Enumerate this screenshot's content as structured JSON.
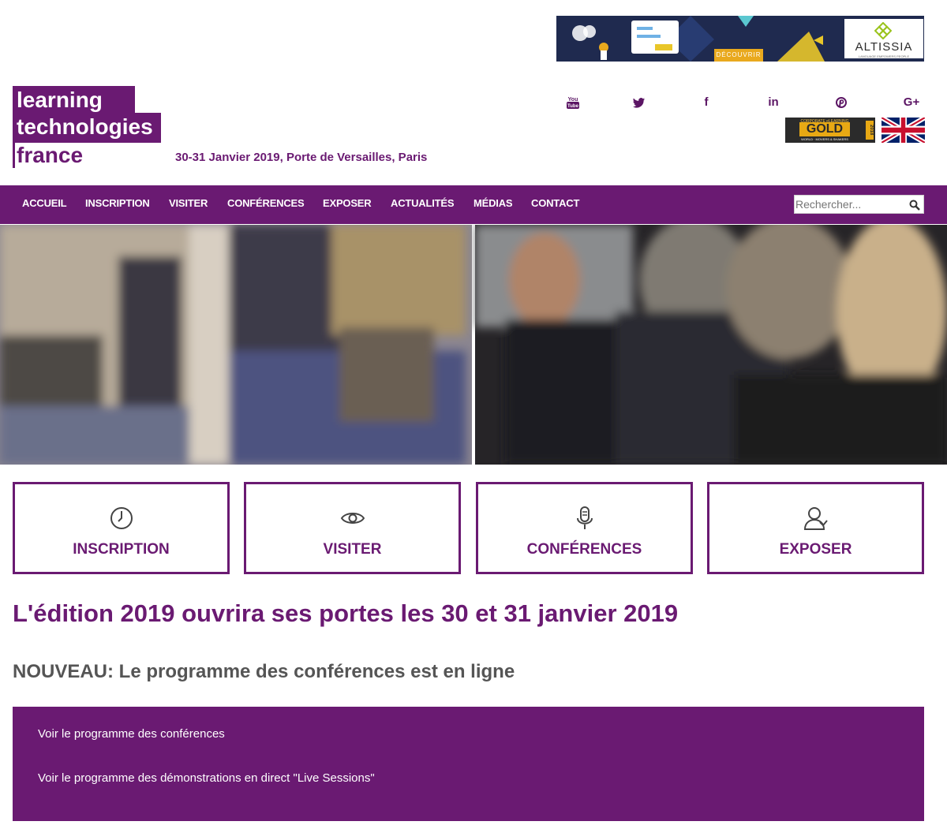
{
  "ad": {
    "cta": "DÉCOUVRIR",
    "brand": "ALTISSIA",
    "tagline": "LANGUAGE EMPOWERS PEOPLE"
  },
  "logo": {
    "line1": "learning",
    "line2": "technologies",
    "line3": "france"
  },
  "event_date": "30-31 Janvier 2019, Porte de Versailles, Paris",
  "social": [
    {
      "icon": "youtube-icon",
      "glyph": "You Tube"
    },
    {
      "icon": "twitter-icon",
      "glyph": "🐦"
    },
    {
      "icon": "facebook-icon",
      "glyph": "f"
    },
    {
      "icon": "linkedin-icon",
      "glyph": "in"
    },
    {
      "icon": "pinterest-icon",
      "glyph": "℗"
    },
    {
      "icon": "google-plus-icon",
      "glyph": "G+"
    }
  ],
  "award_badge": {
    "top": "CORPORATE eLEARNING",
    "main": "GOLD",
    "bottom": "WORLD · MOVERS & SHAKERS",
    "year": "2018"
  },
  "nav": {
    "items": [
      "ACCUEIL",
      "INSCRIPTION",
      "VISITER",
      "CONFÉRENCES",
      "EXPOSER",
      "ACTUALITÉS",
      "MÉDIAS",
      "CONTACT"
    ],
    "search_placeholder": "Rechercher..."
  },
  "cards": [
    {
      "label": "INSCRIPTION",
      "icon": "clock-icon"
    },
    {
      "label": "VISITER",
      "icon": "eye-icon"
    },
    {
      "label": "CONFÉRENCES",
      "icon": "microphone-icon"
    },
    {
      "label": "EXPOSER",
      "icon": "user-icon"
    }
  ],
  "headline": "L'édition 2019 ouvrira ses portes les 30 et 31 janvier 2019",
  "subhead": "NOUVEAU: Le programme des conférences est en ligne",
  "links": [
    "Voir le programme des conférences",
    "Voir le programme des démonstrations en direct \"Live Sessions\""
  ],
  "colors": {
    "brand_purple": "#6a1a72",
    "gray_text": "#555555",
    "gold": "#e8a914"
  }
}
